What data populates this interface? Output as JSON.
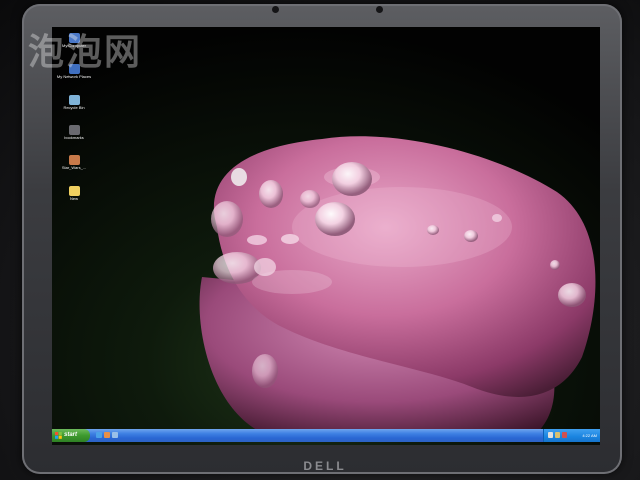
{
  "watermark": {
    "text": "泡泡网"
  },
  "bezel": {
    "brand": "DELL"
  },
  "desktop": {
    "icons": [
      {
        "label": "My Computer",
        "icon": "my-computer-icon",
        "color": "#4a78c8"
      },
      {
        "label": "My Network Places",
        "icon": "network-places-icon",
        "color": "#3f6fc0"
      },
      {
        "label": "Recycle Bin",
        "icon": "recycle-bin-icon",
        "color": "#7fb3d8"
      },
      {
        "label": "bookmarks",
        "icon": "bookmarks-icon",
        "color": "#6a6a70"
      },
      {
        "label": "Star_Wars_...",
        "icon": "image-file-icon",
        "color": "#c87a4a"
      },
      {
        "label": "New",
        "icon": "folder-icon",
        "color": "#f0d060"
      }
    ],
    "wallpaper": "pink petal with water droplets"
  },
  "taskbar": {
    "start_label": "start",
    "quick_launch": [
      "browser-icon",
      "media-player-icon",
      "show-desktop-icon"
    ],
    "clock": "4:22 AM"
  },
  "colors": {
    "taskbar": "#2a66d3",
    "start_button": "#3d9a2e",
    "tray": "#1a84e0"
  }
}
